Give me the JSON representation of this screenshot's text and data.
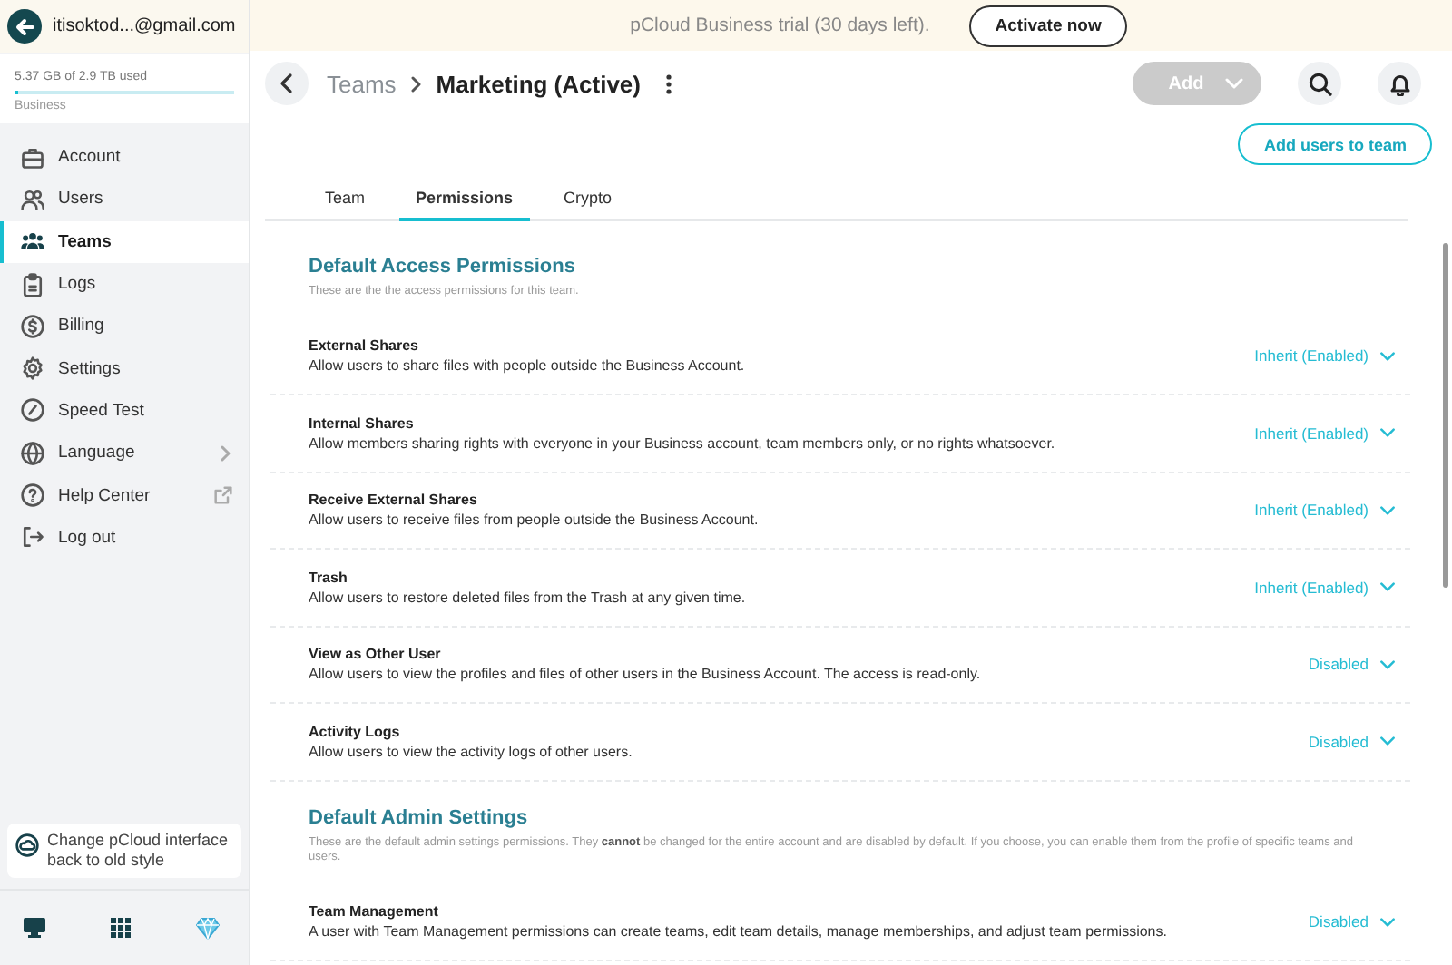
{
  "account": {
    "email": "itisoktod...@gmail.com",
    "storage": "5.37 GB of 2.9 TB used",
    "level": 0.01,
    "plan": "Business"
  },
  "sidebar": {
    "items": [
      {
        "label": "Account",
        "selected": false
      },
      {
        "label": "Users",
        "selected": false
      },
      {
        "label": "Teams",
        "selected": true
      },
      {
        "label": "Logs",
        "selected": false
      },
      {
        "label": "Billing",
        "selected": false
      },
      {
        "label": "Settings",
        "selected": false
      },
      {
        "label": "Speed Test",
        "selected": false
      },
      {
        "label": "Language",
        "selected": false
      },
      {
        "label": "Help Center",
        "selected": false
      },
      {
        "label": "Log out",
        "selected": false
      }
    ],
    "switch_style": "Change pCloud interface back to old style"
  },
  "banner": {
    "text": "pCloud Business trial (30 days left).",
    "button": "Activate now"
  },
  "header": {
    "parent": "Teams",
    "title": "Marketing (Active)",
    "add_button": "Add",
    "add_disabled": true
  },
  "add_users_button": "Add users to team",
  "tabs": [
    {
      "label": "Team",
      "selected": false
    },
    {
      "label": "Permissions",
      "selected": true
    },
    {
      "label": "Crypto",
      "selected": false
    }
  ],
  "sections": [
    {
      "title": "Default Access Permissions",
      "description": "These are the the access permissions for this team.",
      "rows": [
        {
          "name": "External Shares",
          "description": "Allow users to share files with people outside the Business Account.",
          "value": "Inherit (Enabled)"
        },
        {
          "name": "Internal Shares",
          "description": "Allow members sharing rights with everyone in your Business account, team members only, or no rights whatsoever.",
          "value": "Inherit (Enabled)"
        },
        {
          "name": "Receive External Shares",
          "description": "Allow users to receive files from people outside the Business Account.",
          "value": "Inherit (Enabled)"
        },
        {
          "name": "Trash",
          "description": "Allow users to restore deleted files from the Trash at any given time.",
          "value": "Inherit (Enabled)"
        },
        {
          "name": "View as Other User",
          "description": "Allow users to view the profiles and files of other users in the Business Account. The access is read-only.",
          "value": "Disabled"
        },
        {
          "name": "Activity Logs",
          "description": "Allow users to view the activity logs of other users.",
          "value": "Disabled"
        }
      ]
    },
    {
      "title": "Default Admin Settings",
      "description": "These are the default admin settings permissions. They **cannot** be changed for the entire account and are disabled by default. If you choose, you can enable them from the profile of specific teams and users.",
      "rows": [
        {
          "name": "Team Management",
          "description": "A user with Team Management permissions can create teams, edit team details, manage memberships, and adjust team permissions.",
          "value": "Disabled"
        }
      ]
    }
  ]
}
